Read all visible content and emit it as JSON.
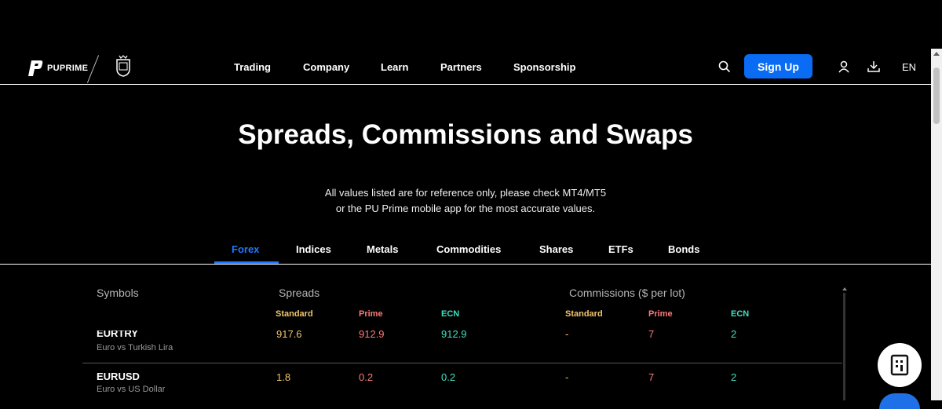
{
  "header": {
    "logo_text": "PUPRIME",
    "nav": [
      "Trading",
      "Company",
      "Learn",
      "Partners",
      "Sponsorship"
    ],
    "signup_label": "Sign Up",
    "language": "EN"
  },
  "page": {
    "title": "Spreads, Commissions and Swaps",
    "subtitle_line1": "All values listed are for reference only, please check MT4/MT5",
    "subtitle_line2": "or the PU Prime mobile app for the most accurate values."
  },
  "tabs": [
    "Forex",
    "Indices",
    "Metals",
    "Commodities",
    "Shares",
    "ETFs",
    "Bonds"
  ],
  "active_tab": "Forex",
  "table": {
    "col_symbols": "Symbols",
    "col_spreads": "Spreads",
    "col_commissions": "Commissions ($ per lot)",
    "spread_sub": [
      "Standard",
      "Prime",
      "ECN"
    ],
    "commission_sub": [
      "Standard",
      "Prime",
      "ECN"
    ],
    "rows": [
      {
        "symbol": "EURTRY",
        "desc": "Euro vs Turkish Lira",
        "spread_std": "917.6",
        "spread_prime": "912.9",
        "spread_ecn": "912.9",
        "comm_std": "-",
        "comm_prime": "7",
        "comm_ecn": "2"
      },
      {
        "symbol": "EURUSD",
        "desc": "Euro vs US Dollar",
        "spread_std": "1.8",
        "spread_prime": "0.2",
        "spread_ecn": "0.2",
        "comm_std": "-",
        "comm_prime": "7",
        "comm_ecn": "2"
      }
    ]
  },
  "colors": {
    "accent": "#0a6cf5",
    "standard": "#f2c66d",
    "prime": "#ff7a7a",
    "ecn": "#40e0c0"
  }
}
